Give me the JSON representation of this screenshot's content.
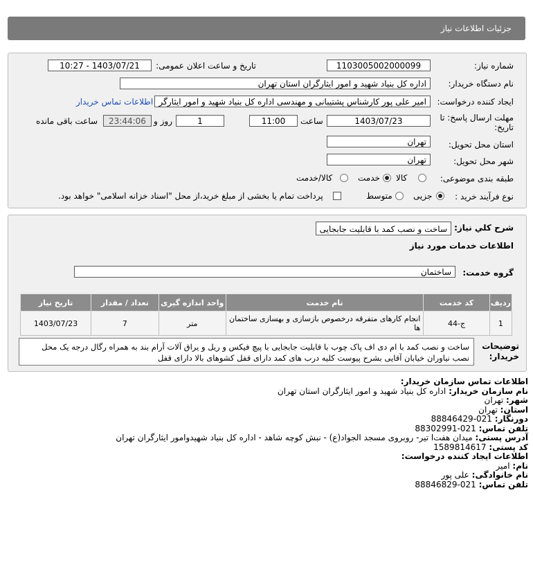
{
  "header": {
    "title": "جزئیات اطلاعات نیاز"
  },
  "form": {
    "need_number_label": "شماره نیاز:",
    "need_number": "1103005002000099",
    "announce_label": "تاریخ و ساعت اعلان عمومی:",
    "announce_value": "1403/07/21 - 10:27",
    "buyer_org_label": "نام دستگاه خریدار:",
    "buyer_org": "اداره کل بنیاد شهید و امور ایثارگران استان تهران",
    "creator_label": "ایجاد کننده درخواست:",
    "creator": "امیر علی پور کارشناس پشتیبانی و مهندسی اداره کل بنیاد شهید و امور ایثارگر",
    "buyer_contact_link": "اطلاعات تماس خریدار",
    "deadline_label_1": "مهلت ارسال پاسخ: تا",
    "deadline_label_2": "تاریخ:",
    "deadline_date": "1403/07/23",
    "time_label": "ساعت",
    "deadline_time": "11:00",
    "days_value": "1",
    "days_label": "روز و",
    "remaining_time": "23:44:06",
    "remaining_label": "ساعت باقی مانده",
    "delivery_province_label": "استان محل تحویل:",
    "delivery_province": "تهران",
    "delivery_city_label": "شهر محل تحویل:",
    "delivery_city": "تهران",
    "category_label": "طبقه بندی موضوعی:",
    "category_options": [
      "کالا",
      "خدمت",
      "کالا/خدمت"
    ],
    "category_selected": "خدمت",
    "process_label": "نوع فرآیند خرید :",
    "process_options": [
      "جزیی",
      "متوسط"
    ],
    "process_selected": "جزیی",
    "payment_note": "پرداخت تمام یا بخشی از مبلغ خرید،از محل \"اسناد خزانه اسلامی\" خواهد بود."
  },
  "need": {
    "summary_label": "شرح کلي نياز:",
    "summary_value": "ساخت و نصب کمد با قابلیت جابجایی",
    "services_title": "اطلاعات خدمات مورد نياز",
    "service_group_label": "گروه خدمت:",
    "service_group": "ساختمان",
    "table": {
      "headers": [
        "ردیف",
        "کد خدمت",
        "نام خدمت",
        "واحد اندازه گیری",
        "تعداد / مقدار",
        "تاریخ نیاز"
      ],
      "rows": [
        [
          "1",
          "ج-44",
          "انجام کارهای متفرقه درخصوص بازسازی و بهسازی ساختمان ها",
          "متر",
          "7",
          "1403/07/23"
        ]
      ]
    },
    "buyer_desc_label_1": "توضیحات",
    "buyer_desc_label_2": "خریدار:",
    "buyer_desc": "ساخت و نصب کمد با ام دی اف پاک چوب با قابلیت جابجایی با پیچ فیکس و ریل و یراق آلات آرام بند به همراه رگال درجه یک محل نصب نیاوران خیابان آقایی بشرح پیوست کلیه درب های کمد دارای قفل کشوهای بالا دارای قفل"
  },
  "contact": {
    "title": "اطلاعات تماس سازمان خریدار:",
    "org_label": "نام سازمان خریدار:",
    "org": "اداره کل بنیاد شهید و امور ایثارگران استان تهران",
    "city_label": "شهر:",
    "city": "تهران",
    "province_label": "استان:",
    "province": "تهران",
    "fax_label": "دورنگار:",
    "fax": "021-88846429",
    "phone_label": "تلفن تماس:",
    "phone": "021-88302991",
    "address_label": "آدرس پستی:",
    "address": "میدان هفت‌ا تیر- روبروی مسجد الجواد(ع) - نبش کوچه شاهد - اداره کل بنیاد شهیدوامور ایثارگران تهران",
    "postal_label": "کد پستی:",
    "postal": "1589814617",
    "creator_title": "اطلاعات ایجاد کننده درخواست:",
    "first_name_label": "نام:",
    "first_name": "امیر",
    "last_name_label": "نام خانوادگی:",
    "last_name": "علی پور",
    "creator_phone_label": "تلفن تماس:",
    "creator_phone": "021-88846829"
  }
}
